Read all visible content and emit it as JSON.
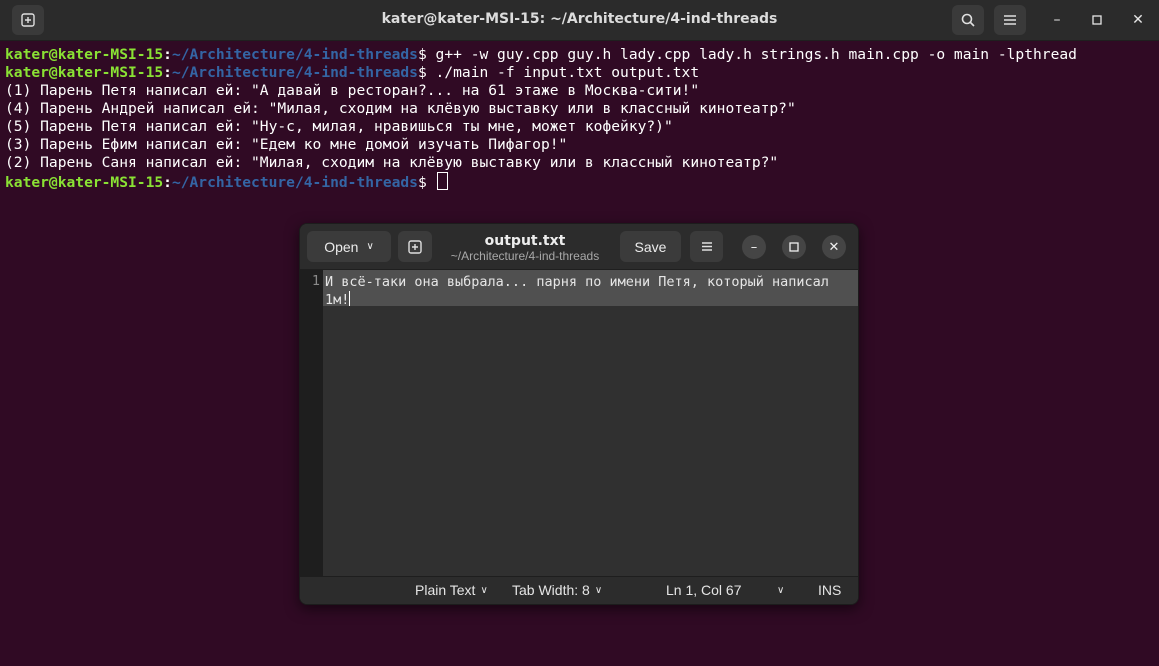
{
  "terminal": {
    "title": "kater@kater-MSI-15: ~/Architecture/4-ind-threads",
    "prompt_user": "kater@kater-MSI-15",
    "prompt_path": "~/Architecture/4-ind-threads",
    "prompt_sign": "$ ",
    "lines": [
      {
        "kind": "prompt",
        "cmd": "g++ -w guy.cpp guy.h lady.cpp lady.h strings.h main.cpp -o main -lpthread"
      },
      {
        "kind": "prompt",
        "cmd": "./main -f input.txt output.txt"
      },
      {
        "kind": "output",
        "text": "(1) Парень Петя написал ей: \"А давай в ресторан?... на 61 этаже в Москва-сити!\""
      },
      {
        "kind": "output",
        "text": "(4) Парень Андрей написал ей: \"Милая, сходим на клёвую выставку или в классный кинотеатр?\""
      },
      {
        "kind": "output",
        "text": "(5) Парень Петя написал ей: \"Ну-с, милая, нравишься ты мне, может кофейку?)\""
      },
      {
        "kind": "output",
        "text": "(3) Парень Ефим написал ей: \"Едем ко мне домой изучать Пифагор!\""
      },
      {
        "kind": "output",
        "text": "(2) Парень Саня написал ей: \"Милая, сходим на клёвую выставку или в классный кинотеатр?\""
      },
      {
        "kind": "prompt",
        "cmd": ""
      }
    ]
  },
  "editor": {
    "title": "output.txt",
    "subtitle": "~/Architecture/4-ind-threads",
    "open_label": "Open",
    "save_label": "Save",
    "line_number": "1",
    "content": "И всё-таки она выбрала... парня по имени Петя, который написал 1м!",
    "status": {
      "language": "Plain Text",
      "tab_width": "Tab Width: 8",
      "position": "Ln 1, Col 67",
      "mode": "INS"
    }
  }
}
